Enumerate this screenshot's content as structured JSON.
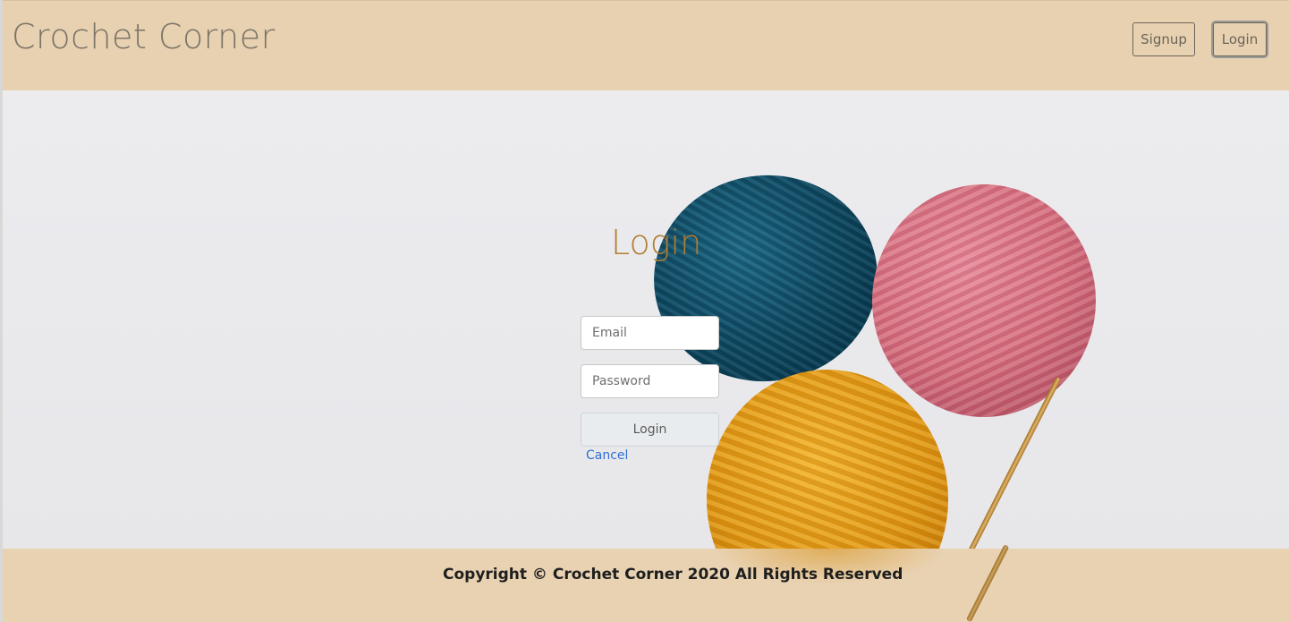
{
  "header": {
    "brand": "Crochet Corner",
    "signup_label": "Signup",
    "login_label": "Login"
  },
  "login_form": {
    "title": "Login",
    "email_placeholder": "Email",
    "password_placeholder": "Password",
    "submit_label": "Login",
    "cancel_label": "Cancel"
  },
  "footer": {
    "copyright": "Copyright © Crochet Corner 2020 All Rights Reserved"
  },
  "colors": {
    "header_bg": "#e8d1b0",
    "title_accent": "#b07d32",
    "link": "#2f6fd1"
  }
}
